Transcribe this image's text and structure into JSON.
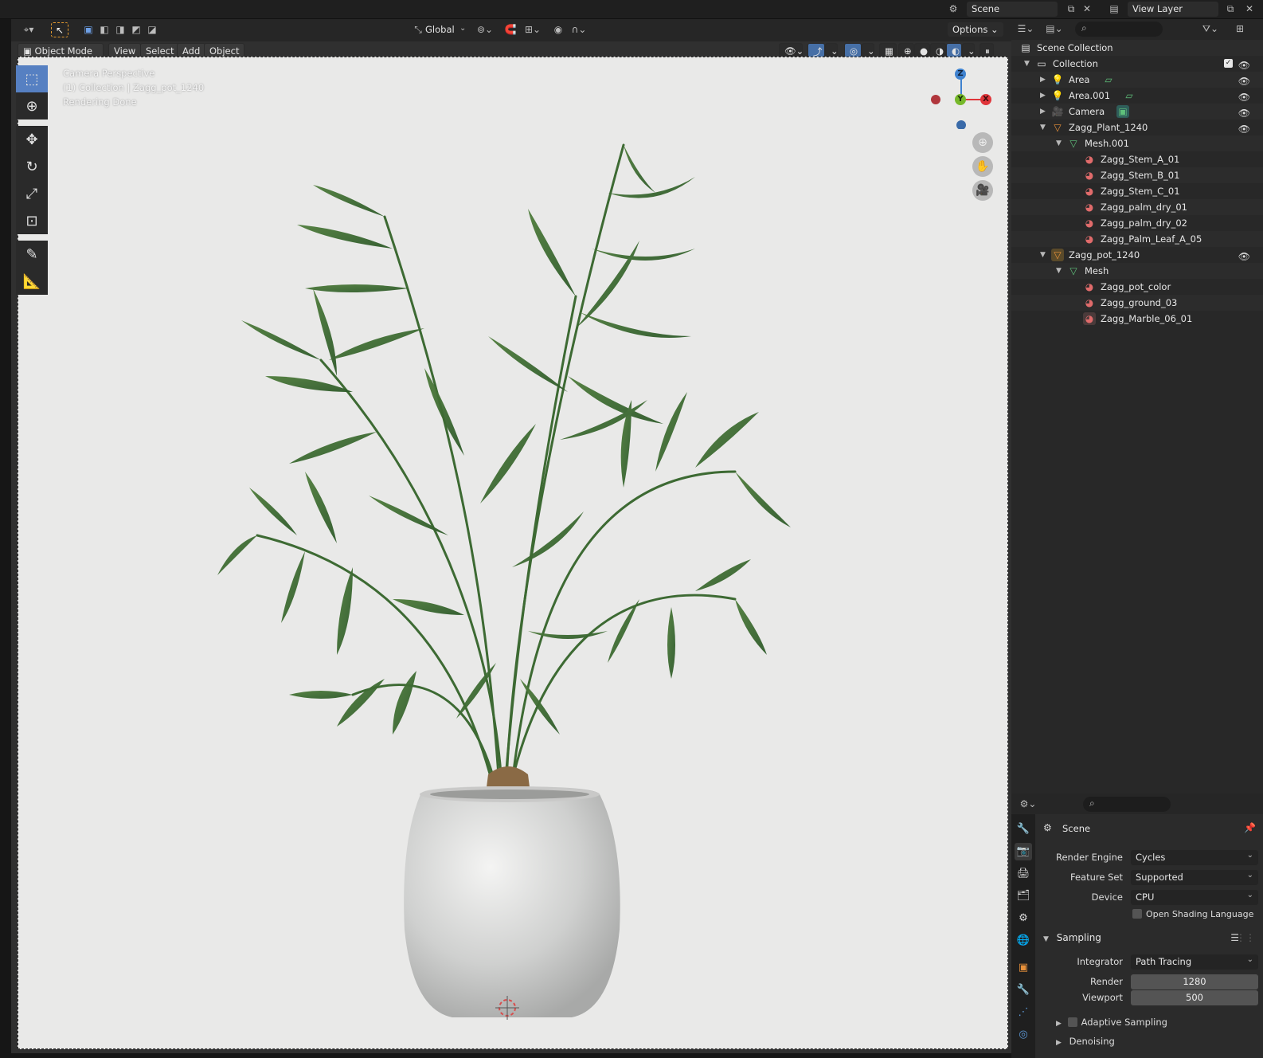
{
  "topbar": {
    "scene_label": "Scene",
    "view_layer_label": "View Layer"
  },
  "viewport_header": {
    "transform_orientation": "Global",
    "options_label": "Options",
    "mode": "Object Mode",
    "menu": [
      "View",
      "Select",
      "Add",
      "Object"
    ]
  },
  "viewport_overlay": {
    "line1": "Camera Perspective",
    "line2": "(1) Collection | Zagg_pot_1240",
    "line3": "Rendering Done"
  },
  "gizmo": {
    "z": "Z",
    "y": "Y",
    "x": "X"
  },
  "outliner": {
    "scene_collection": "Scene Collection",
    "rows": [
      {
        "label": "Collection"
      },
      {
        "label": "Area"
      },
      {
        "label": "Area.001"
      },
      {
        "label": "Camera"
      },
      {
        "label": "Zagg_Plant_1240"
      },
      {
        "label": "Mesh.001"
      },
      {
        "label": "Zagg_Stem_A_01"
      },
      {
        "label": "Zagg_Stem_B_01"
      },
      {
        "label": "Zagg_Stem_C_01"
      },
      {
        "label": "Zagg_palm_dry_01"
      },
      {
        "label": "Zagg_palm_dry_02"
      },
      {
        "label": "Zagg_Palm_Leaf_A_05"
      },
      {
        "label": "Zagg_pot_1240"
      },
      {
        "label": "Mesh"
      },
      {
        "label": "Zagg_pot_color"
      },
      {
        "label": "Zagg_ground_03"
      },
      {
        "label": "Zagg_Marble_06_01"
      }
    ]
  },
  "properties": {
    "context": "Scene",
    "render_engine_label": "Render Engine",
    "render_engine": "Cycles",
    "feature_set_label": "Feature Set",
    "feature_set": "Supported",
    "device_label": "Device",
    "device": "CPU",
    "osl_label": "Open Shading Language",
    "sampling_label": "Sampling",
    "integrator_label": "Integrator",
    "integrator": "Path Tracing",
    "render_label": "Render",
    "render_samples": "1280",
    "viewport_label": "Viewport",
    "viewport_samples": "500",
    "adaptive_label": "Adaptive Sampling",
    "denoising_label": "Denoising"
  },
  "colors": {
    "accent": "#5680c2",
    "bg": "#282828",
    "x_axis": "#e0353a",
    "y_axis": "#76b82a",
    "z_axis": "#3f82cf"
  }
}
